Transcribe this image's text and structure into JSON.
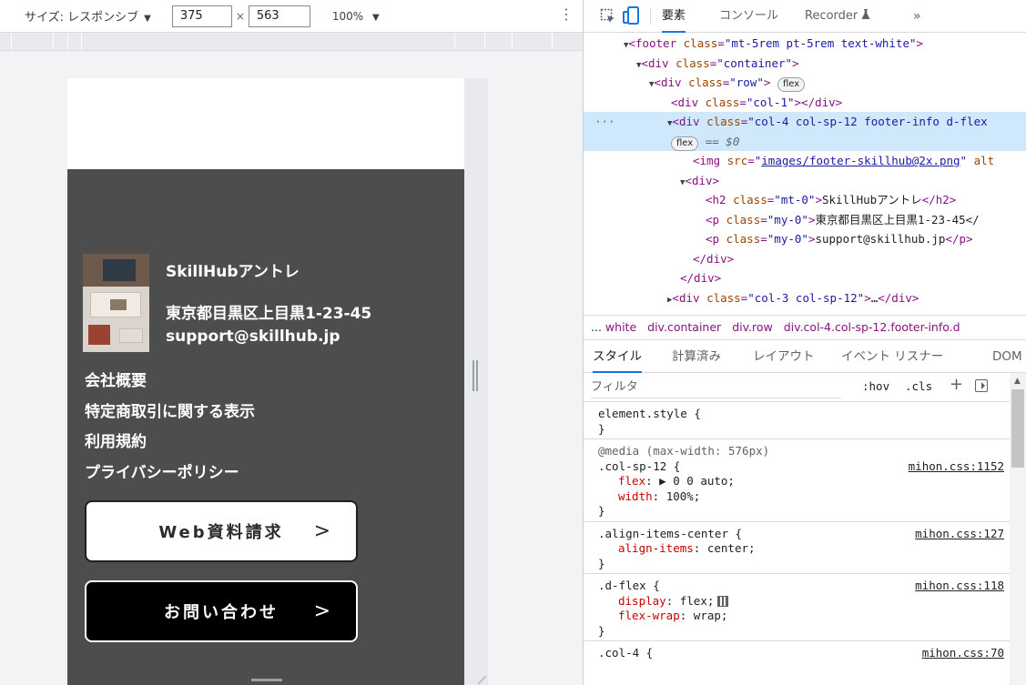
{
  "device_toolbar": {
    "dimensions_label": "サイズ: レスポンシブ",
    "width": "375",
    "times": "×",
    "height": "563",
    "zoom": "100%",
    "dropdown_glyph": "▼",
    "menu_glyph": "⋮"
  },
  "page_footer": {
    "company_name": "SkillHubアントレ",
    "address": "東京都目黒区上目黒1-23-45",
    "email": "support@skillhub.jp",
    "links": [
      "会社概要",
      "特定商取引に関する表示",
      "利用規約",
      "プライバシーポリシー"
    ],
    "cta_web": "Web資料請求",
    "cta_contact": "お問い合わせ",
    "cta_arrow": ">"
  },
  "devtools": {
    "tabs": {
      "elements": "要素",
      "console": "コンソール",
      "recorder": "Recorder",
      "more": "»"
    },
    "dom": {
      "footer_open": "footer",
      "footer_class": "mt-5rem pt-5rem text-white",
      "container_class": "container",
      "row_class": "row",
      "flex_badge": "flex",
      "col1_class": "col-1",
      "selected_class": "col-4 col-sp-12 footer-info d-flex",
      "selected_marker": "== $0",
      "img_src": "images/footer-skillhub@2x.png",
      "img_tail": "alt",
      "h2_class": "mt-0",
      "h2_text": "SkillHubアントレ",
      "p_class": "my-0",
      "p1_text": "東京都目黒区上目黒1-23-45</",
      "p2_text": "support@skillhub.jp",
      "col3_class": "col-3 col-sp-12",
      "ellipsis": "…",
      "dots": "···"
    },
    "breadcrumbs": {
      "more": "...",
      "items": [
        "white",
        "div.container",
        "div.row",
        "div.col-4.col-sp-12.footer-info.d"
      ]
    },
    "sub_tabs": {
      "styles": "スタイル",
      "computed": "計算済み",
      "layout": "レイアウト",
      "event_listeners": "イベント リスナー",
      "dom": "DOM"
    },
    "filter": {
      "placeholder": "フィルタ",
      "hov": ":hov",
      "cls": ".cls",
      "plus": "+"
    },
    "styles": {
      "element_style": "element.style {",
      "close": "}",
      "media_query": "@media (max-width: 576px)",
      "r1_selector": ".col-sp-12 {",
      "r1_source": "mihon.css:1152",
      "r1_p1_name": "flex",
      "r1_p1_value": "▶ 0 0 auto;",
      "r1_p2_name": "width",
      "r1_p2_value": "100%;",
      "r2_selector": ".align-items-center {",
      "r2_source": "mihon.css:127",
      "r2_p1_name": "align-items",
      "r2_p1_value": "center;",
      "r3_selector": ".d-flex {",
      "r3_source": "mihon.css:118",
      "r3_p1_name": "display",
      "r3_p1_value": "flex;",
      "r3_p2_name": "flex-wrap",
      "r3_p2_value": "wrap;",
      "r4_selector": ".col-4 {",
      "r4_source": "mihon.css:70"
    }
  },
  "colors": {
    "footer_bg": "#4d4d4d",
    "selection": "#cfe8fc",
    "tab_accent": "#1a73e8",
    "tag": "#881280",
    "attr": "#994500",
    "value": "#1a1aa6",
    "prop_name": "#c80000"
  }
}
